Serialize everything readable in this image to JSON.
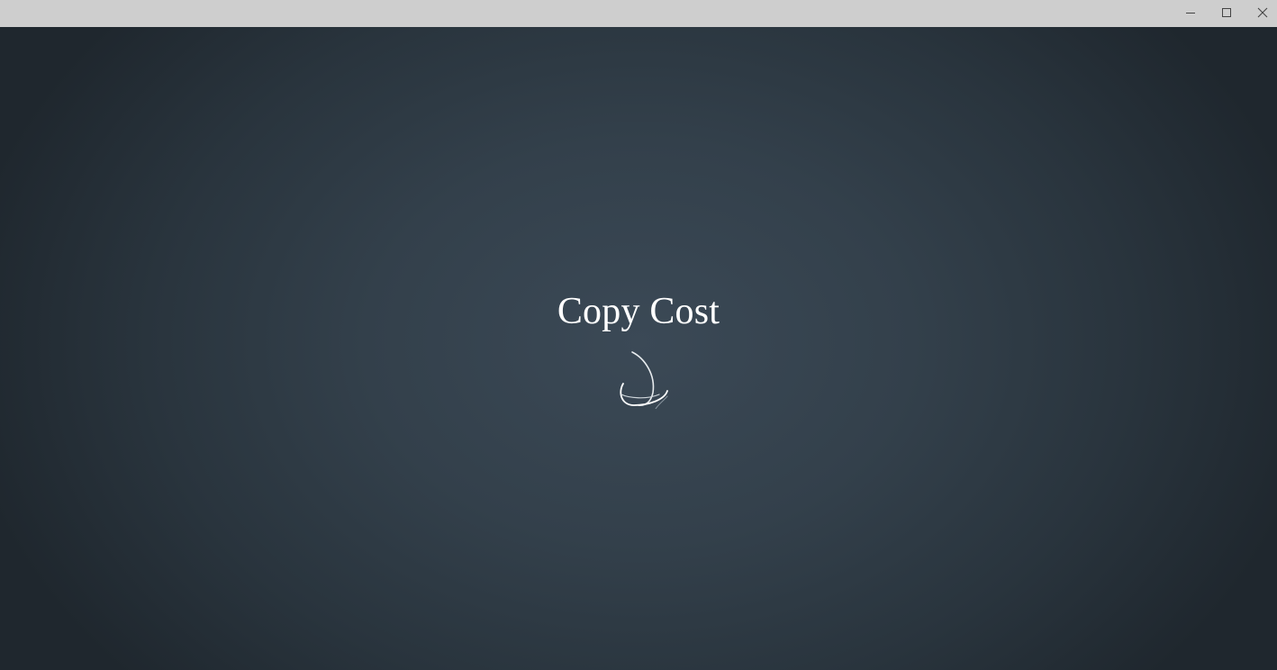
{
  "window": {
    "controls": {
      "minimize_icon": "minimize-icon",
      "maximize_icon": "maximize-icon",
      "close_icon": "close-icon"
    },
    "titlebar_color": "#cecece"
  },
  "splash": {
    "title": "Copy Cost",
    "spinner_icon": "loading-spinner-icon",
    "text_color": "#ffffff",
    "background_center": "#3b4956",
    "background_edge": "#1f272e"
  }
}
